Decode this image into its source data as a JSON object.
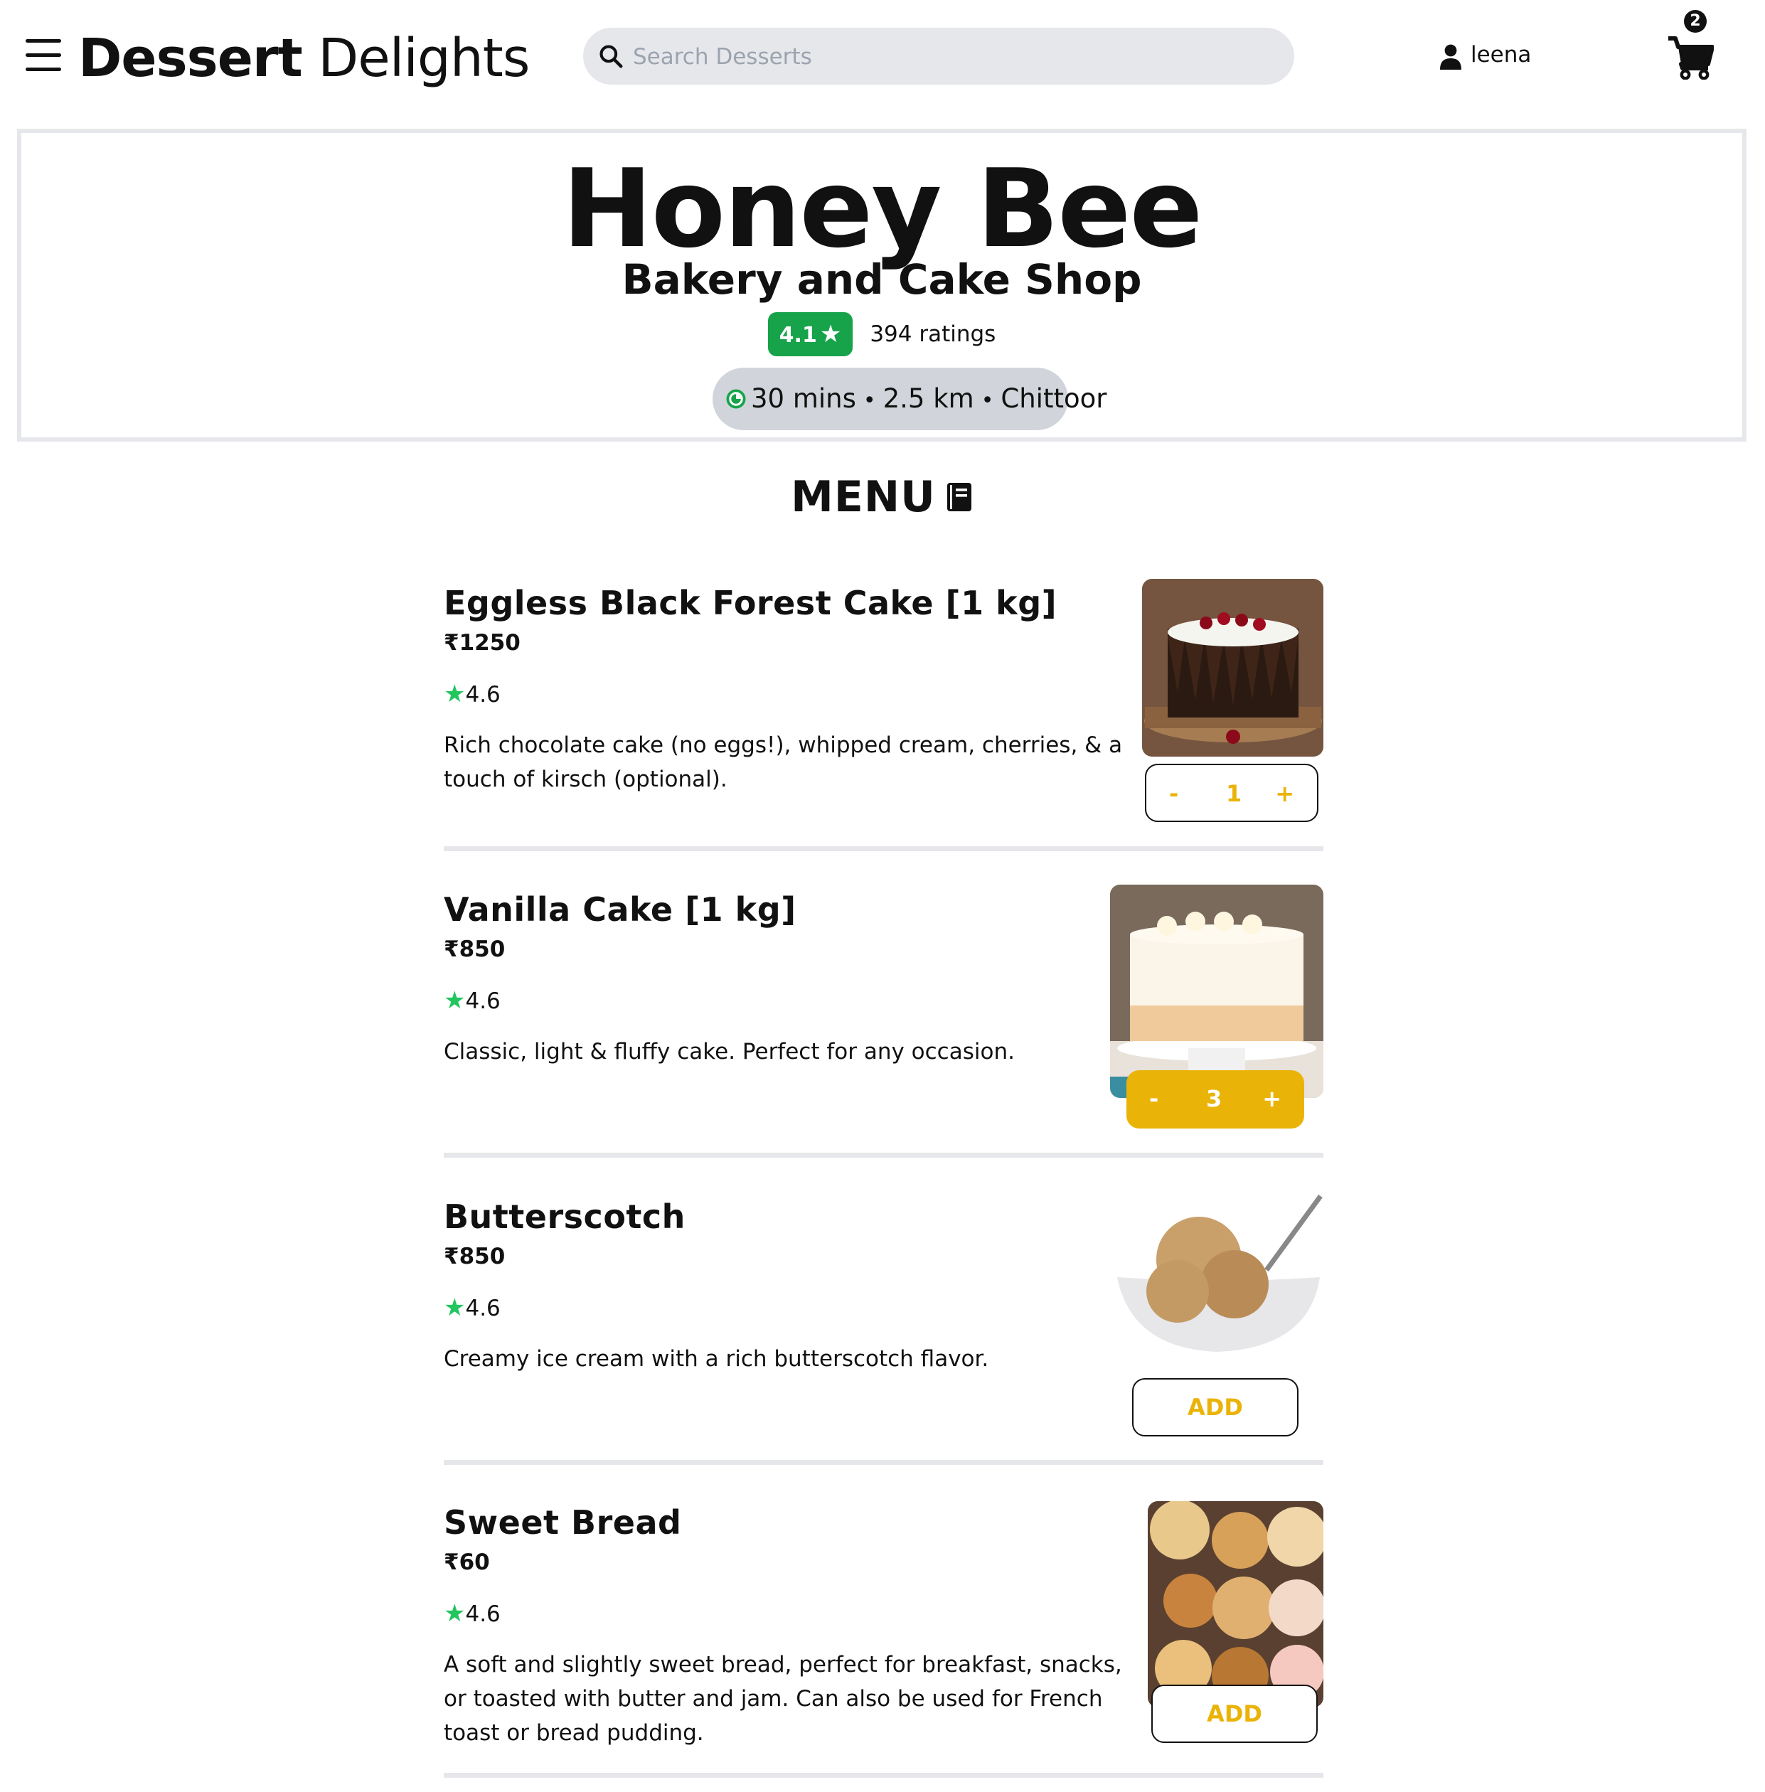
{
  "header": {
    "brand_bold": "Dessert",
    "brand_light": "Delights",
    "search_placeholder": "Search Desserts",
    "user_name": "leena",
    "cart_count": "2"
  },
  "restaurant": {
    "name": "Honey Bee",
    "type": "Bakery and Cake Shop",
    "rating": "4.1",
    "rating_count": "394 ratings",
    "time": "30 mins",
    "distance": "2.5 km",
    "location": "Chittoor",
    "rating_color": "#16a34a"
  },
  "menu": {
    "title": "MENU",
    "accent_color": "#eab308",
    "items": [
      {
        "title": "Eggless Black Forest Cake [1 kg]",
        "price": "₹1250",
        "rating": "4.6",
        "description": "Rich chocolate cake (no eggs!), whipped cream, cherries, & a touch of kirsch (optional).",
        "qty": "1",
        "minus": "-",
        "plus": "+"
      },
      {
        "title": "Vanilla Cake [1 kg]",
        "price": "₹850",
        "rating": "4.6",
        "description": "Classic, light & fluffy cake. Perfect for any occasion.",
        "qty": "3",
        "minus": "-",
        "plus": "+"
      },
      {
        "title": "Butterscotch",
        "price": "₹850",
        "rating": "4.6",
        "description": "Creamy ice cream with a rich butterscotch flavor.",
        "button": "ADD"
      },
      {
        "title": "Sweet Bread",
        "price": "₹60",
        "rating": "4.6",
        "description": "A soft and slightly sweet bread, perfect for breakfast, snacks, or toasted with butter and jam. Can also be used for French toast or bread pudding.",
        "button": "ADD"
      }
    ]
  }
}
